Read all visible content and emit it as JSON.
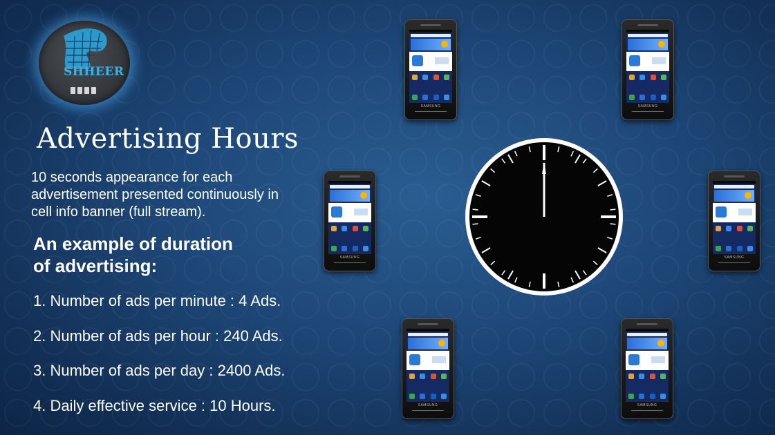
{
  "logo": {
    "text": "SHHEER"
  },
  "title": "Advertising Hours",
  "description": "10 seconds appearance for each advertisement presented continuously in cell info banner (full stream).",
  "example_heading_line1": "An example of duration",
  "example_heading_line2": "of advertising:",
  "items": [
    "1. Number of ads per minute : 4 Ads.",
    "2. Number of ads per hour : 240 Ads.",
    "3. Number of ads per day : 2400 Ads.",
    "4. Daily effective service : 10 Hours."
  ],
  "phone_brand": "SAMSUNG",
  "colors": {
    "accent": "#39b3e6",
    "clock_face": "#000000",
    "clock_ring": "#ffffff"
  }
}
